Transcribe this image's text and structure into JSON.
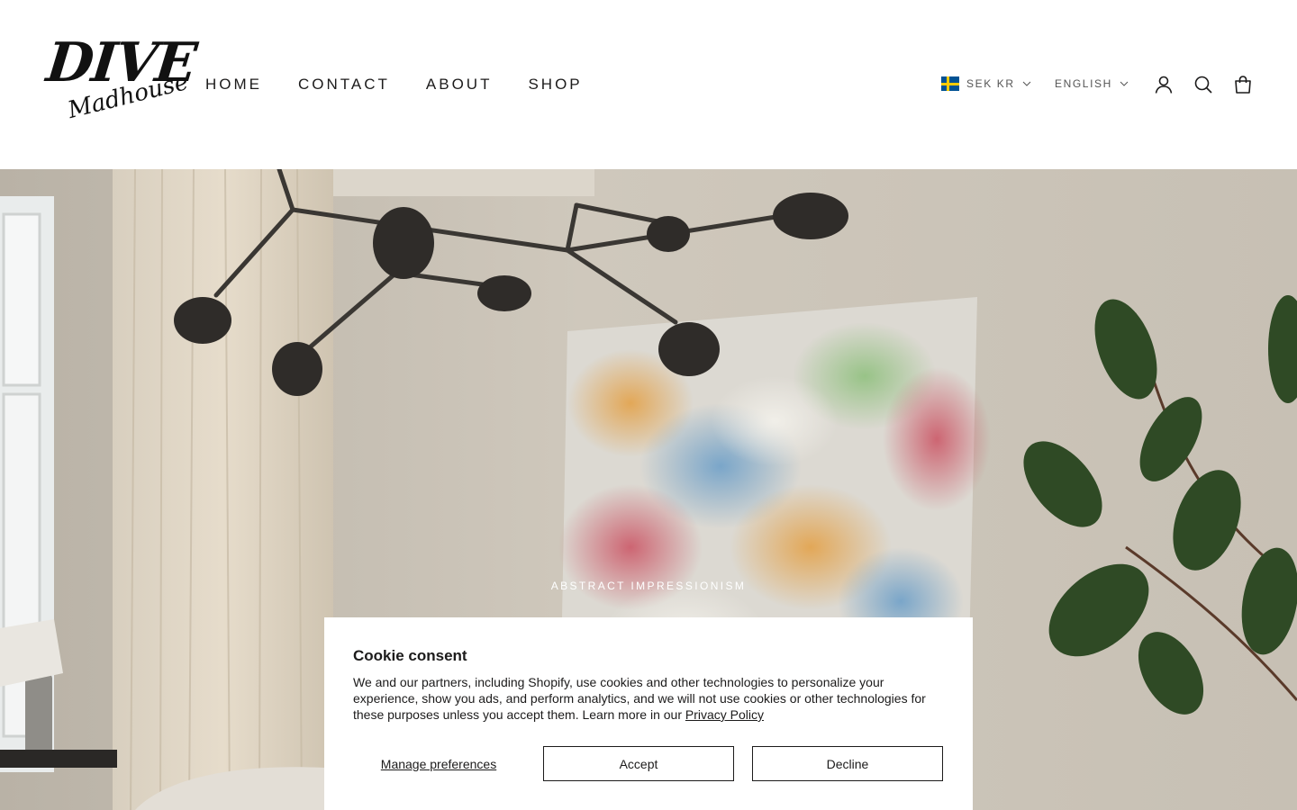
{
  "brand": {
    "logo_main": "DIVE",
    "logo_sub": "Madhouse"
  },
  "nav": {
    "items": [
      {
        "label": "HOME"
      },
      {
        "label": "CONTACT"
      },
      {
        "label": "ABOUT"
      },
      {
        "label": "SHOP"
      }
    ]
  },
  "locale": {
    "currency": "SEK KR",
    "currency_flag": "sweden-flag",
    "language": "ENGLISH"
  },
  "header_icons": [
    "account-icon",
    "search-icon",
    "cart-icon"
  ],
  "hero": {
    "subtitle": "ABSTRACT IMPRESSIONISM"
  },
  "cookie": {
    "title": "Cookie consent",
    "text": "We and our partners, including Shopify, use cookies and other technologies to personalize your experience, show you ads, and perform analytics, and we will not use cookies or other technologies for these purposes unless you accept them. Learn more in our ",
    "privacy_link": "Privacy Policy",
    "manage_label": "Manage preferences",
    "accept_label": "Accept",
    "decline_label": "Decline"
  },
  "colors": {
    "text": "#1c1b1b",
    "wall": "#c8c1b5",
    "modal_bg": "#ffffff"
  }
}
